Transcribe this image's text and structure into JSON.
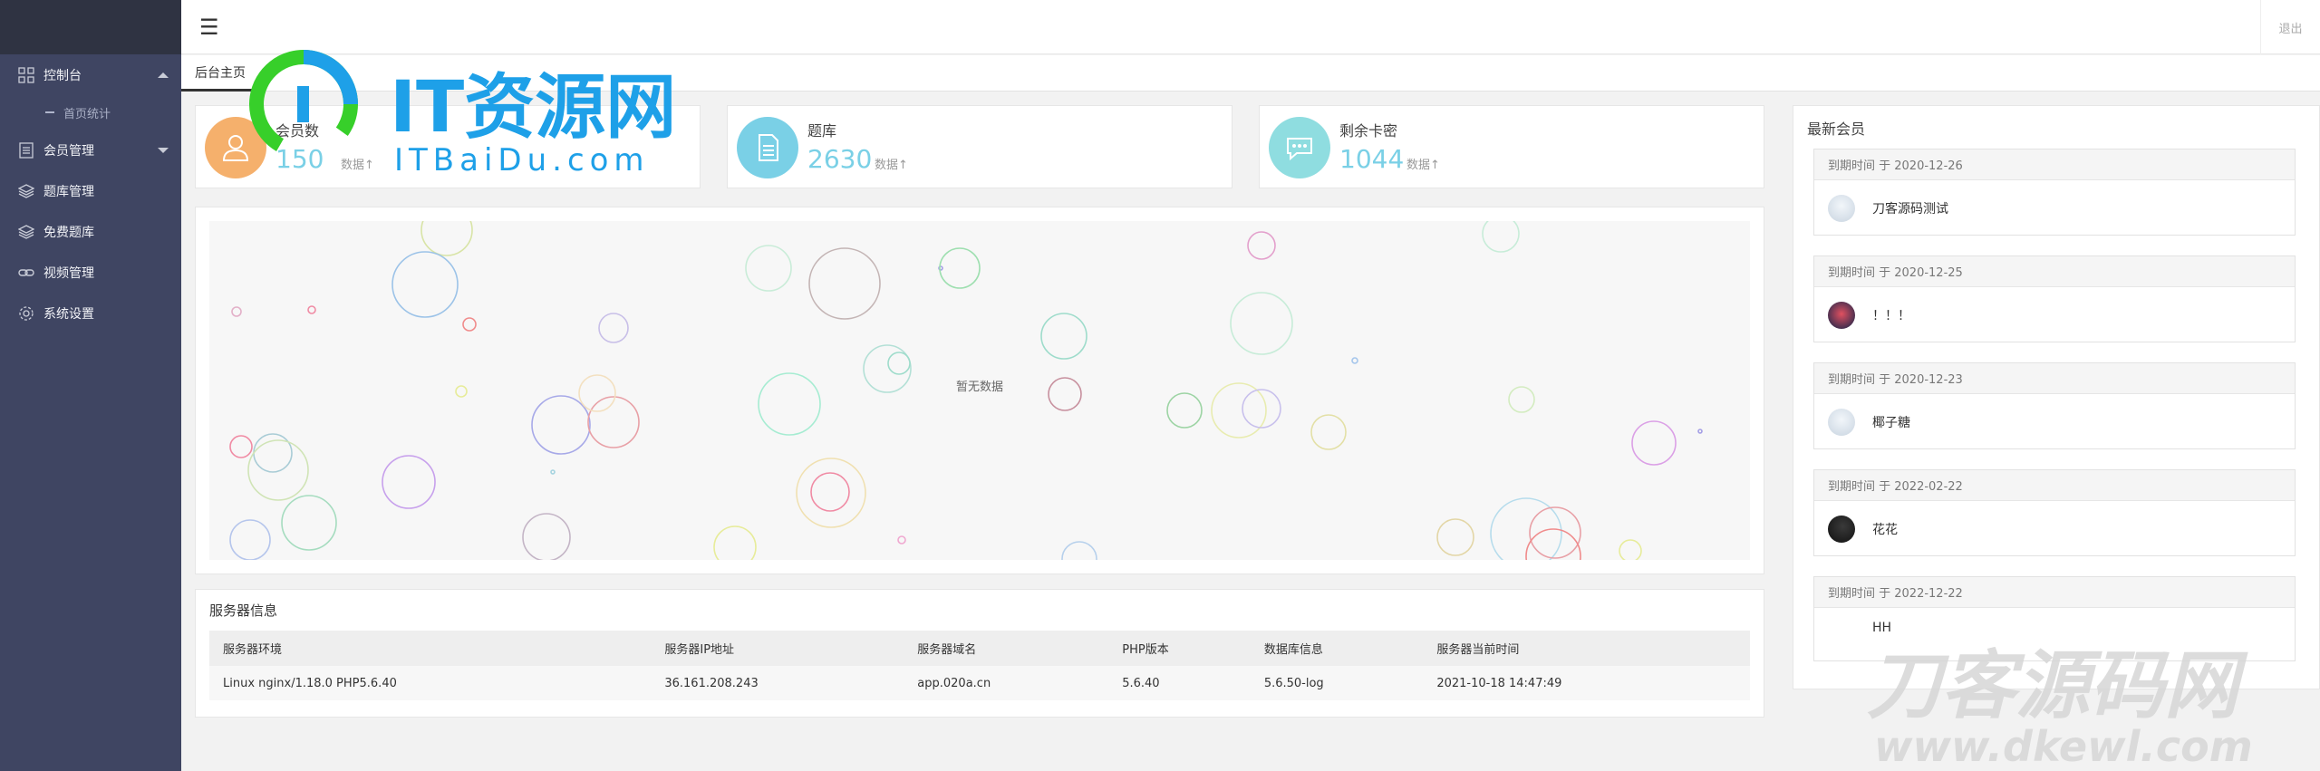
{
  "sidebar": {
    "items": [
      {
        "label": "控制台",
        "icon": "dashboard-icon",
        "expanded": true
      },
      {
        "label": "会员管理",
        "icon": "members-icon",
        "expanded": false
      },
      {
        "label": "题库管理",
        "icon": "layers-icon"
      },
      {
        "label": "免费题库",
        "icon": "layers-icon"
      },
      {
        "label": "视频管理",
        "icon": "link-icon"
      },
      {
        "label": "系统设置",
        "icon": "gear-icon"
      }
    ],
    "sub_item": "首页统计"
  },
  "header": {
    "menu_icon": "☰",
    "logout": "退出"
  },
  "tabs": [
    {
      "label": "后台主页",
      "active": true
    }
  ],
  "stats": [
    {
      "label": "会员数",
      "value": "150",
      "unit": "数据↑",
      "icon": "user-icon",
      "color": "#f5b06c"
    },
    {
      "label": "题库",
      "value": "2630",
      "unit": "数据↑",
      "icon": "document-icon",
      "color": "#7ad0e6"
    },
    {
      "label": "剩余卡密",
      "value": "1044",
      "unit": "数据↑",
      "icon": "chat-icon",
      "color": "#8fdde0"
    }
  ],
  "chart": {
    "empty_text": "暂无数据"
  },
  "server": {
    "title": "服务器信息",
    "headers": [
      "服务器环境",
      "服务器IP地址",
      "服务器域名",
      "PHP版本",
      "数据库信息",
      "服务器当前时间"
    ],
    "row": [
      "Linux nginx/1.18.0 PHP5.6.40",
      "36.161.208.243",
      "app.020a.cn",
      "5.6.40",
      "5.6.50-log",
      "2021-10-18 14:47:49"
    ]
  },
  "members": {
    "title": "最新会员",
    "list": [
      {
        "expire": "到期时间 于 2020-12-26",
        "name": "刀客源码测试"
      },
      {
        "expire": "到期时间 于 2020-12-25",
        "name": "！！！"
      },
      {
        "expire": "到期时间 于 2020-12-23",
        "name": "椰子糖"
      },
      {
        "expire": "到期时间 于 2022-02-22",
        "name": "花花"
      },
      {
        "expire": "到期时间 于 2022-12-22",
        "name": "HH"
      }
    ]
  },
  "watermarks": {
    "top_brand": "IT资源网",
    "top_url": "ITBaiDu.com",
    "bottom_brand": "刀客源码网",
    "bottom_url": "www.dkewl.com"
  }
}
